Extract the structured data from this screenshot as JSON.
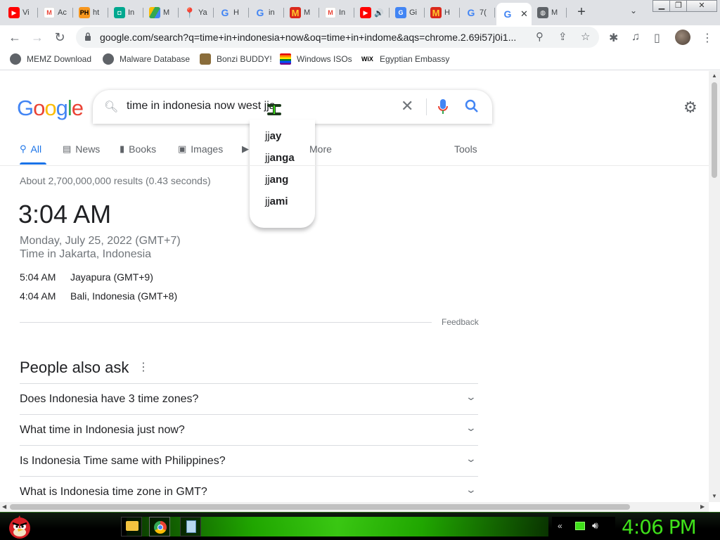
{
  "browser": {
    "tabs": [
      {
        "label": "Vi",
        "icon": "youtube-icon",
        "color": "#ff0000"
      },
      {
        "label": "Ac",
        "icon": "gmail-icon",
        "color": "#ea4335"
      },
      {
        "label": "ht",
        "icon": "ph-icon",
        "color": "#f7971e"
      },
      {
        "label": "In",
        "icon": "app-icon",
        "color": "#00a88f"
      },
      {
        "label": "M",
        "icon": "drive-icon",
        "color": "#1fa463"
      },
      {
        "label": "Ya",
        "icon": "maps-icon",
        "color": "#34a853"
      },
      {
        "label": "H",
        "icon": "google-icon",
        "color": "#4285f4"
      },
      {
        "label": "in",
        "icon": "google-icon",
        "color": "#4285f4"
      },
      {
        "label": "M",
        "icon": "mcdonalds-icon",
        "color": "#da291c"
      },
      {
        "label": "In",
        "icon": "gmail-icon",
        "color": "#ea4335"
      },
      {
        "label": "",
        "icon": "youtube-icon",
        "color": "#ff0000"
      },
      {
        "label": "Gi",
        "icon": "translate-icon",
        "color": "#4285f4"
      },
      {
        "label": "H",
        "icon": "mcdonalds-icon",
        "color": "#da291c"
      },
      {
        "label": "7(",
        "icon": "google-icon",
        "color": "#4285f4"
      },
      {
        "label": "",
        "icon": "google-icon",
        "color": "#4285f4",
        "active": true
      },
      {
        "label": "M",
        "icon": "globe-icon",
        "color": "#5f6368"
      }
    ],
    "url": "google.com/search?q=time+in+indonesia+now&oq=time+in+indome&aqs=chrome.2.69i57j0i1...",
    "bookmarks": [
      {
        "label": "MEMZ Download",
        "icon": "globe-icon"
      },
      {
        "label": "Malware Database",
        "icon": "globe-icon"
      },
      {
        "label": "Bonzi BUDDY!",
        "icon": "bonzi-icon"
      },
      {
        "label": "Windows ISOs",
        "icon": "windows-flag-icon"
      },
      {
        "label": "Egyptian Embassy",
        "icon": "wix-icon"
      }
    ]
  },
  "google": {
    "logo": "Google",
    "query": "time in indonesia now west jja",
    "suggestions": [
      {
        "prefix": "jj",
        "rest": "ay"
      },
      {
        "prefix": "jj",
        "rest": "anga"
      },
      {
        "prefix": "jj",
        "rest": "ang"
      },
      {
        "prefix": "jj",
        "rest": "ami"
      }
    ],
    "tabs": [
      "All",
      "News",
      "Books",
      "Images",
      "More",
      "Tools"
    ],
    "stats": "About 2,700,000,000 results (0.43 seconds)",
    "time": "3:04 AM",
    "date_tz": "Monday, July 25, 2022 (GMT+7)",
    "location": "Time in Jakarta, Indonesia",
    "other_zones": [
      {
        "time": "5:04 AM",
        "place": "Jayapura (GMT+9)"
      },
      {
        "time": "4:04 AM",
        "place": "Bali, Indonesia (GMT+8)"
      }
    ],
    "feedback": "Feedback",
    "people_also_ask": {
      "title": "People also ask",
      "questions": [
        "Does Indonesia have 3 time zones?",
        "What time in Indonesia just now?",
        "Is Indonesia Time same with Philippines?",
        "What is Indonesia time zone in GMT?"
      ]
    }
  },
  "taskbar": {
    "clock": "4:06 PM"
  },
  "colors": {
    "google_blue": "#4285f4",
    "google_red": "#ea4335",
    "google_yellow": "#fbbc05",
    "google_green": "#34a853",
    "link_blue": "#1a73e8",
    "taskbar_green": "#3fe01a"
  }
}
